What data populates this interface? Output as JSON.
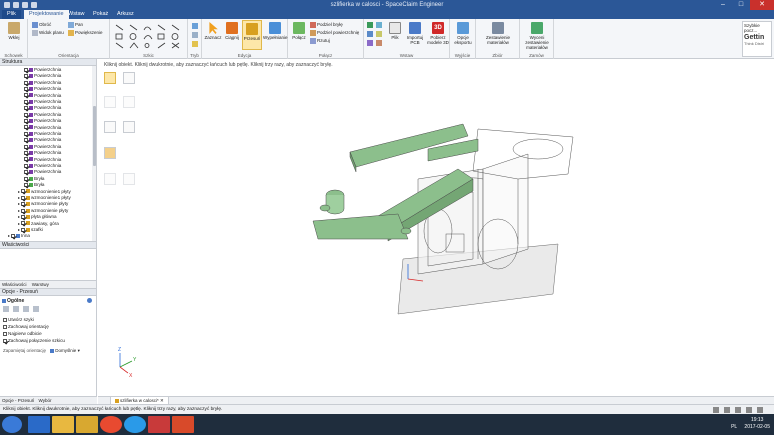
{
  "window": {
    "title": "szlifierka w calosci - SpaceClaim Engineer",
    "minimize_glyph": "–",
    "maximize_glyph": "□",
    "close_glyph": "✕"
  },
  "tabs": [
    "Plik",
    "Projektowanie",
    "Wstaw",
    "Pokaż",
    "Arkusz"
  ],
  "ribbon": {
    "clipboard": {
      "label": "Schowek",
      "paste": "Wklej"
    },
    "orient": {
      "label": "Orientacja",
      "items": [
        "Obróć",
        "Pan",
        "Powiększenie"
      ],
      "extra": "Widok planu"
    },
    "sketch": {
      "label": "Szkic"
    },
    "mode": {
      "label": "Tryb"
    },
    "edit": {
      "label": "Edycja",
      "select": "Zaznacz",
      "pull": "Ciągnij",
      "move": "Przesuń",
      "fill": "Wypełnianie"
    },
    "intersect": {
      "label": "Połącz",
      "combine": "Połącz",
      "items": [
        "Podziel bryłę",
        "Podziel powierzchnię",
        "Rzutuj"
      ]
    },
    "insert": {
      "label": "Wstaw",
      "items": [
        "Plik",
        "Importuj PCB",
        "Pobierz modele 3D"
      ]
    },
    "output": {
      "label": "Wyjście",
      "items": [
        "Opcje eksportu"
      ]
    },
    "assembly": {
      "label": "Zbiór",
      "items": [
        "Zestawienie materiałów"
      ]
    },
    "bom": {
      "label": "Zamów",
      "items": [
        "Wyceni zestawienie materiałów"
      ]
    },
    "quickstart": {
      "title": "Szybkie pocz...",
      "getting": "Gettin",
      "sub": "Think Distri"
    }
  },
  "left_panel": {
    "structure_title": "Struktura",
    "tree": [
      "Powierzchnia",
      "Powierzchnia",
      "Powierzchnia",
      "Powierzchnia",
      "Powierzchnia",
      "Powierzchnia",
      "Powierzchnia",
      "Powierzchnia",
      "Powierzchnia",
      "Powierzchnia",
      "Powierzchnia",
      "Powierzchnia",
      "Powierzchnia",
      "Powierzchnia",
      "Powierzchnia",
      "Powierzchnia",
      "Powierzchnia",
      "Bryła",
      "Bryła",
      "wzmocnienie1 płyty",
      "wzmocnienie1 płyty",
      "wzmocnienie płyty",
      "wzmocnienie płyty",
      "płyta główna",
      "zawiasy, góra",
      "szafki",
      "Inna"
    ],
    "properties_title": "Właściwości",
    "prop_tabs": [
      "Właściwości",
      "Warstwy"
    ],
    "options_title": "Opcje - Przesuń",
    "options_section": "Ogólne",
    "options": [
      {
        "label": "Utwórz szyki",
        "checked": false
      },
      {
        "label": "Zachowaj orientację",
        "checked": false
      },
      {
        "label": "Najpierw odbicie",
        "checked": false
      },
      {
        "label": "Zachowaj połączenie szkicu",
        "checked": true
      }
    ],
    "orient_label": "Zapamiętaj orientację",
    "orient_value": "Domyślnie",
    "bottom_tabs": [
      "Opcje - Przesuń",
      "Wybór"
    ]
  },
  "canvas": {
    "hint": "Kliknij obiekt. Kliknij dwukrotnie, aby zaznaczyć łańcuch lub pętlę. Kliknij trzy razy, aby zaznaczyć bryłę.",
    "doc_tab": "szlifierka w calosci*",
    "triad_axes": [
      "Z",
      "Y",
      "X"
    ]
  },
  "status": {
    "text": "Kliknij obiekt. Kliknij dwukrotnie, aby zaznaczyć łańcuch lub pętlę. Kliknij trzy razy, aby zaznaczyć bryłę."
  },
  "taskbar": {
    "lang": "PL",
    "time": "19:13",
    "date": "2017-02-05"
  },
  "colors": {
    "title_bg": "#2b5797",
    "model_green": "#8cbf8c",
    "model_edge": "#4a4a4a",
    "taskbar": "#1f2d3d"
  }
}
